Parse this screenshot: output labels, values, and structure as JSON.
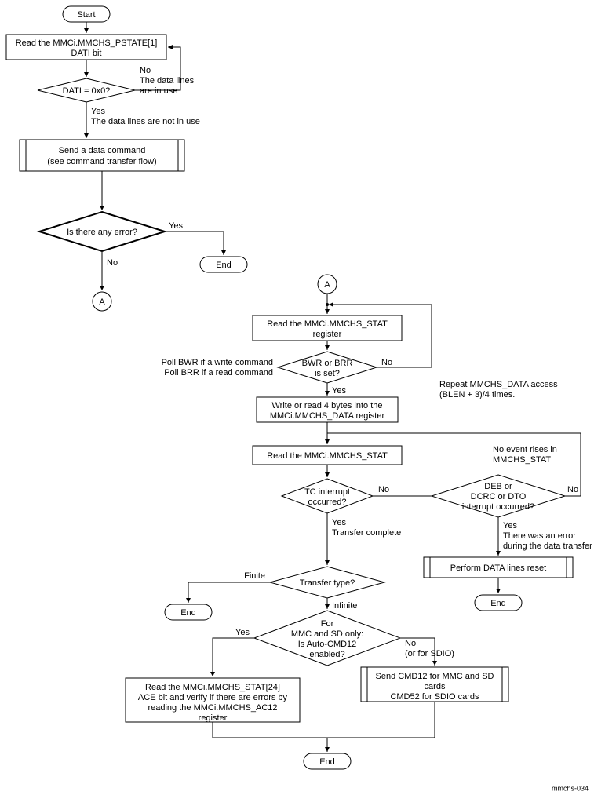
{
  "terminals": {
    "start": "Start",
    "end1": "End",
    "end2": "End",
    "end3": "End",
    "end4": "End",
    "connA1": "A",
    "connA2": "A"
  },
  "procs": {
    "readPstate": {
      "l1": "Read the MMCi.MMCHS_PSTATE[1]",
      "l2": "DATI bit"
    },
    "sendCmd": {
      "l1": "Send a data command",
      "l2": "(see command transfer flow)"
    },
    "readStat1": {
      "l1": "Read the MMCi.MMCHS_STAT",
      "l2": "register"
    },
    "rw4bytes": {
      "l1": "Write or read 4 bytes into the",
      "l2": "MMCi.MMCHS_DATA register"
    },
    "readStat2": {
      "l1": "Read the MMCi.MMCHS_STAT"
    },
    "dataReset": {
      "l1": "Perform DATA lines reset"
    },
    "readAce": {
      "l1": "Read the MMCi.MMCHS_STAT[24]",
      "l2": "ACE bit and verify if there are errors by",
      "l3": "reading the MMCi.MMCHS_AC12",
      "l4": "register"
    },
    "sendCmd12": {
      "l1": "Send CMD12 for MMC and SD",
      "l2": "cards",
      "l3": "CMD52 for SDIO cards"
    }
  },
  "decisions": {
    "dati": "DATI = 0x0?",
    "anyError": "Is there any error?",
    "bwrBrr": {
      "l1": "BWR or BRR",
      "l2": "is set?"
    },
    "tc": {
      "l1": "TC interrupt",
      "l2": "occurred?"
    },
    "debDcrc": {
      "l1": "DEB or",
      "l2": "DCRC or DTO",
      "l3": "interrupt occurred?"
    },
    "transferType": "Transfer type?",
    "autoCmd12": {
      "l1": "For",
      "l2": "MMC and SD only:",
      "l3": "Is Auto-CMD12",
      "l4": "enabled?"
    }
  },
  "annotations": {
    "datiNo": {
      "l1": "No",
      "l2": "The data lines",
      "l3": "are in use"
    },
    "datiYes": {
      "l1": "Yes",
      "l2": "The data lines are not in use"
    },
    "errYes": "Yes",
    "errNo": "No",
    "pollNote": {
      "l1": "Poll BWR if a write command",
      "l2": "Poll BRR if a read command"
    },
    "bwrNo": "No",
    "bwrYes": "Yes",
    "repeatNote": {
      "l1": "Repeat MMCHS_DATA access",
      "l2": "(BLEN + 3)/4 times."
    },
    "tcNo": "No",
    "tcYes": {
      "l1": "Yes",
      "l2": "Transfer complete"
    },
    "debNo": "No",
    "noEvent": {
      "l1": "No event rises in",
      "l2": "MMCHS_STAT"
    },
    "debYes": {
      "l1": "Yes",
      "l2": "There was an error",
      "l3": "during the data transfer"
    },
    "finite": "Finite",
    "infinite": "Infinite",
    "autoYes": "Yes",
    "autoNo": {
      "l1": "No",
      "l2": "(or for SDIO)"
    },
    "figId": "mmchs-034"
  }
}
